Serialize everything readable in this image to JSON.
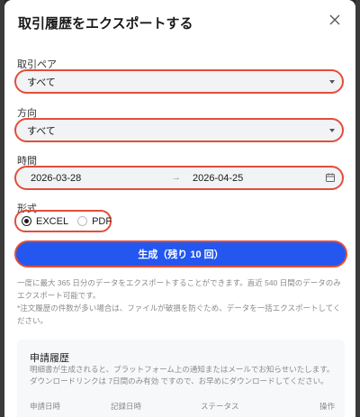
{
  "modal": {
    "title": "取引履歴をエクスポートする"
  },
  "pair": {
    "label": "取引ペア",
    "value": "すべて"
  },
  "direction": {
    "label": "方向",
    "value": "すべて"
  },
  "time": {
    "label": "時間",
    "start": "2026-03-28",
    "arrow": "→",
    "end": "2026-04-25"
  },
  "format": {
    "label": "形式",
    "options": [
      "EXCEL",
      "PDF"
    ],
    "selected": "EXCEL"
  },
  "generate": {
    "label": "生成（残り 10 回）"
  },
  "notes": {
    "line1": "一度に最大 365 日分のデータをエクスポートすることができます。直近 540 日間のデータのみエクスポート可能です。",
    "line2": "*注文履歴の件数が多い場合は、ファイルが破損を防ぐため、データを一括エクスポートしてください。"
  },
  "history": {
    "title": "申請履歴",
    "desc": "明細書が生成されると、プラットフォーム上の通知またはメールでお知らせいたします。ダウンロードリンクは 7日間のみ有効 ですので、お早めにダウンロードしてください。",
    "columns": [
      "申請日時",
      "記録日時",
      "ステータス",
      "操作"
    ]
  },
  "colors": {
    "accent": "#2357f0",
    "highlight": "#e24e3a"
  }
}
